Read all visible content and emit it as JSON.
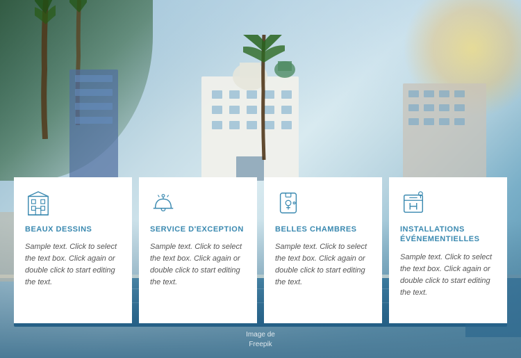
{
  "background": {
    "gradient_start": "#6a9fba",
    "gradient_end": "#4e8caa"
  },
  "image_credit": {
    "line1": "Image de",
    "line2": "Freepik"
  },
  "cards": [
    {
      "id": "beaux-dessins",
      "icon": "building-icon",
      "title": "BEAUX DESSINS",
      "text": "Sample text. Click to select the text box. Click again or double click to start editing the text."
    },
    {
      "id": "service-exception",
      "icon": "bell-icon",
      "title": "SERVICE D'EXCEPTION",
      "text": "Sample text. Click to select the text box. Click again or double click to start editing the text."
    },
    {
      "id": "belles-chambres",
      "icon": "key-icon",
      "title": "BELLES CHAMBRES",
      "text": "Sample text. Click to select the text box. Click again or double click to start editing the text."
    },
    {
      "id": "installations",
      "icon": "hotel-icon",
      "title": "INSTALLATIONS ÉVÉNEMENTIELLES",
      "text": "Sample text. Click to select the text box. Click again or double click to start editing the text."
    }
  ]
}
